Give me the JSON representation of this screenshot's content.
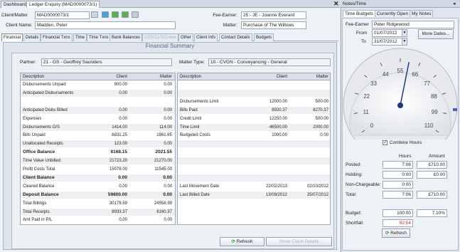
{
  "tabs": {
    "dashboard": "Dashboard",
    "ledger": "Ledger Enquiry (MAD0000073/1)",
    "close": "✕"
  },
  "header": {
    "client_matter_label": "Client/Matter",
    "client_matter_value": "MAD0000073/1",
    "client_name_label": "Client Name:",
    "client_name_value": "Madden, Peter",
    "fee_earner_label": "Fee-Earner:",
    "fee_earner_value": "25 - JE - Joanne Everard",
    "matter_label": "Matter:",
    "matter_value": "Purchase of The Willows"
  },
  "subtabs": [
    "Financial",
    "Details",
    "Financial Txns",
    "Time",
    "Time Txns",
    "Bank Balances",
    "CDS/CLS/Crown",
    "Other",
    "Client Info",
    "Contact Details",
    "Budgets"
  ],
  "summary": {
    "title": "Financial Summary",
    "partner_label": "Partner:",
    "partner_value": "21 - GS - Geoffrey Saunders",
    "matter_type_label": "Matter Type:",
    "matter_type_value": "10 - CVGN - Conveyancing - General"
  },
  "left_table": {
    "headers": {
      "description": "Description",
      "client": "Client",
      "matter": "Matter"
    },
    "rows": [
      {
        "d": "Disbursements Unpaid",
        "c": "900.00",
        "m": "0.00",
        "bold": false
      },
      {
        "d": "Anticipated Disbursements",
        "c": "0.00",
        "m": "0.00",
        "bold": false
      },
      {
        "d": "",
        "c": "",
        "m": "",
        "bold": false
      },
      {
        "d": "Anticipated Disbs Billed",
        "c": "0.00",
        "m": "0.00",
        "bold": false
      },
      {
        "d": "Expenses",
        "c": "0.00",
        "m": "0.00",
        "bold": false
      },
      {
        "d": "Disbursements O/S",
        "c": "1414.00",
        "m": "114.00",
        "bold": false
      },
      {
        "d": "Bills Unpaid",
        "c": "6831.25",
        "m": "1861.65",
        "bold": false
      },
      {
        "d": "Unallocated Receipts",
        "c": "123.00",
        "m": "0.00",
        "bold": false
      },
      {
        "d": "Office Balance",
        "c": "8168.15",
        "m": "2021.55",
        "bold": true
      },
      {
        "d": "Time Value Unbilled",
        "c": "21723.20",
        "m": "21270.00",
        "bold": false
      },
      {
        "d": "Profit Costs Total",
        "c": "15078.00",
        "m": "11545.00",
        "bold": false
      },
      {
        "d": "Client Balance",
        "c": "0.00",
        "m": "0.00",
        "bold": true
      },
      {
        "d": "Cleared Balance",
        "c": "0.00",
        "m": "0.00",
        "bold": false
      },
      {
        "d": "Deposit Balance",
        "c": "59800.00",
        "m": "0.00",
        "bold": true
      },
      {
        "d": "Total Billings",
        "c": "30178.59",
        "m": "24558.99",
        "bold": false
      },
      {
        "d": "Total Receipts",
        "c": "8933.37",
        "m": "8160.37",
        "bold": false
      },
      {
        "d": "Amt Paid in P/L",
        "c": "0.00",
        "m": "0.00",
        "bold": false
      }
    ]
  },
  "right_table": {
    "headers": {
      "description": "Description",
      "client": "Client",
      "matter": "Matter"
    },
    "rows": [
      {
        "d": "",
        "c": "",
        "m": ""
      },
      {
        "d": "",
        "c": "",
        "m": ""
      },
      {
        "d": "Disbursements Limit",
        "c": "12000.00",
        "m": "500.00"
      },
      {
        "d": "Bills Paid",
        "c": "8920.37",
        "m": "8270.37"
      },
      {
        "d": "Credit Limit",
        "c": "12250.00",
        "m": "500.00"
      },
      {
        "d": "Time Limit",
        "c": "46500.00",
        "m": "2000.00"
      },
      {
        "d": "Budgeted Costs",
        "c": "1000.00",
        "m": "0.00"
      },
      {
        "d": "",
        "c": "",
        "m": ""
      },
      {
        "d": "",
        "c": "",
        "m": ""
      },
      {
        "d": "",
        "c": "",
        "m": ""
      },
      {
        "d": "",
        "c": "",
        "m": ""
      },
      {
        "d": "",
        "c": "",
        "m": ""
      },
      {
        "d": "Last Movement Date",
        "c": "22/02/2013",
        "m": "02/10/2012"
      },
      {
        "d": "Last Billed Date",
        "c": "13/09/2012",
        "m": "25/07/2012"
      }
    ]
  },
  "buttons": {
    "refresh": "Refresh",
    "show_client_details": "Show Client Details"
  },
  "notes": {
    "title": "Notes/Time",
    "tabs": [
      "Time Budgets",
      "Currently Open",
      "My Notes"
    ],
    "fee_earner_label": "Fee-Earner",
    "fee_earner_value": "Peter Ridgewood",
    "from_label": "From",
    "from_value": "01/07/2012",
    "to_label": "To",
    "to_value": "31/07/2012",
    "more_dates": "More Dates...",
    "gauge_ticks": [
      "0",
      "11",
      "22",
      "33",
      "44",
      "55",
      "66",
      "77",
      "88",
      "99",
      "110"
    ],
    "gauge_value": 60,
    "combine_hours": "Combine Hours",
    "combine_checked": "✓",
    "col_hours": "Hours",
    "col_amount": "Amount",
    "rows": [
      {
        "label": "Posted:",
        "hours": "7:06",
        "amount": "£710.00"
      },
      {
        "label": "Holding:",
        "hours": "0:00",
        "amount": "£0.00"
      },
      {
        "label": "Non-Chargeable:",
        "hours": "0:00",
        "amount": ""
      },
      {
        "label": "Total:",
        "hours": "7:06",
        "amount": "£710.00"
      }
    ],
    "budget_label": "Budget:",
    "budget_hours": "100:00",
    "budget_pct": "7.10%",
    "shortfall_label": "Shortfall:",
    "shortfall_value": "92:54",
    "refresh": "Refresh"
  },
  "colors": {
    "accent": "#2a5ca8",
    "shortfall": "#c0262d",
    "button_icon": "#3a9a3a"
  }
}
